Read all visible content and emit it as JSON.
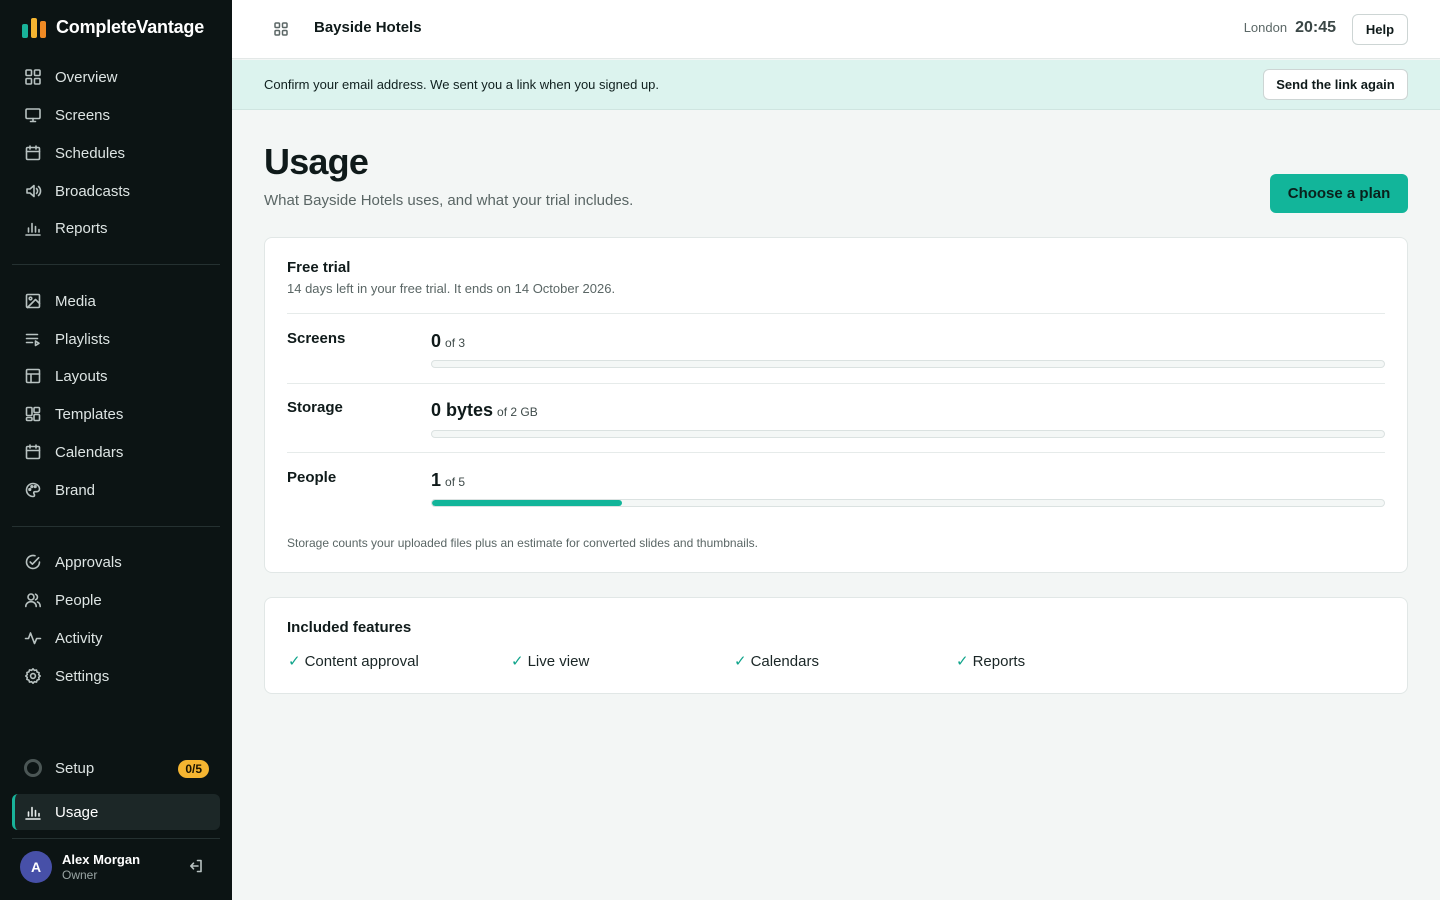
{
  "app": {
    "name": "CompleteVantage",
    "logo_colors": [
      "#19b39a",
      "#f5b531",
      "#f08a24"
    ]
  },
  "sidebar": {
    "groups": [
      [
        {
          "label": "Overview",
          "icon": "grid-icon"
        },
        {
          "label": "Screens",
          "icon": "monitor-icon"
        },
        {
          "label": "Schedules",
          "icon": "calendar-icon"
        },
        {
          "label": "Broadcasts",
          "icon": "speaker-icon"
        },
        {
          "label": "Reports",
          "icon": "bar-chart-icon"
        }
      ],
      [
        {
          "label": "Media",
          "icon": "image-icon"
        },
        {
          "label": "Playlists",
          "icon": "playlist-icon"
        },
        {
          "label": "Layouts",
          "icon": "layout-icon"
        },
        {
          "label": "Templates",
          "icon": "template-icon"
        },
        {
          "label": "Calendars",
          "icon": "calendar-icon"
        },
        {
          "label": "Brand",
          "icon": "palette-icon"
        }
      ],
      [
        {
          "label": "Approvals",
          "icon": "check-circle-icon"
        },
        {
          "label": "People",
          "icon": "users-icon"
        },
        {
          "label": "Activity",
          "icon": "activity-icon"
        },
        {
          "label": "Settings",
          "icon": "gear-icon"
        }
      ]
    ],
    "setup": {
      "label": "Setup",
      "badge": "0/5"
    },
    "usage": {
      "label": "Usage",
      "active": true
    },
    "user": {
      "initial": "A",
      "name": "Alex Morgan",
      "role": "Owner"
    }
  },
  "topbar": {
    "org_name": "Bayside Hotels",
    "city": "London",
    "time": "20:45",
    "help_label": "Help"
  },
  "banner": {
    "text": "Confirm your email address. We sent you a link when you signed up.",
    "button_label": "Send the link again"
  },
  "page": {
    "title": "Usage",
    "subtitle": "What Bayside Hotels uses, and what your trial includes.",
    "plan_button": "Choose a plan"
  },
  "trial": {
    "title": "Free trial",
    "subtitle": "14 days left in your free trial. It ends on 14 October 2026.",
    "metrics": [
      {
        "label": "Screens",
        "value": "0",
        "limit": "of 3",
        "fraction": 0
      },
      {
        "label": "Storage",
        "value": "0 bytes",
        "limit": "of 2 GB",
        "fraction": 0
      },
      {
        "label": "People",
        "value": "1",
        "limit": "of 5",
        "fraction": 0.2
      }
    ],
    "note": "Storage counts your uploaded files plus an estimate for converted slides and thumbnails."
  },
  "features": {
    "title": "Included features",
    "check": "✓",
    "items": [
      "Content approval",
      "Live view",
      "Calendars",
      "Reports"
    ]
  },
  "colors": {
    "accent": "#12b59a",
    "sidebar_bg": "#0c1414",
    "banner_bg": "#dcf3ee",
    "badge": "#f5b531"
  }
}
